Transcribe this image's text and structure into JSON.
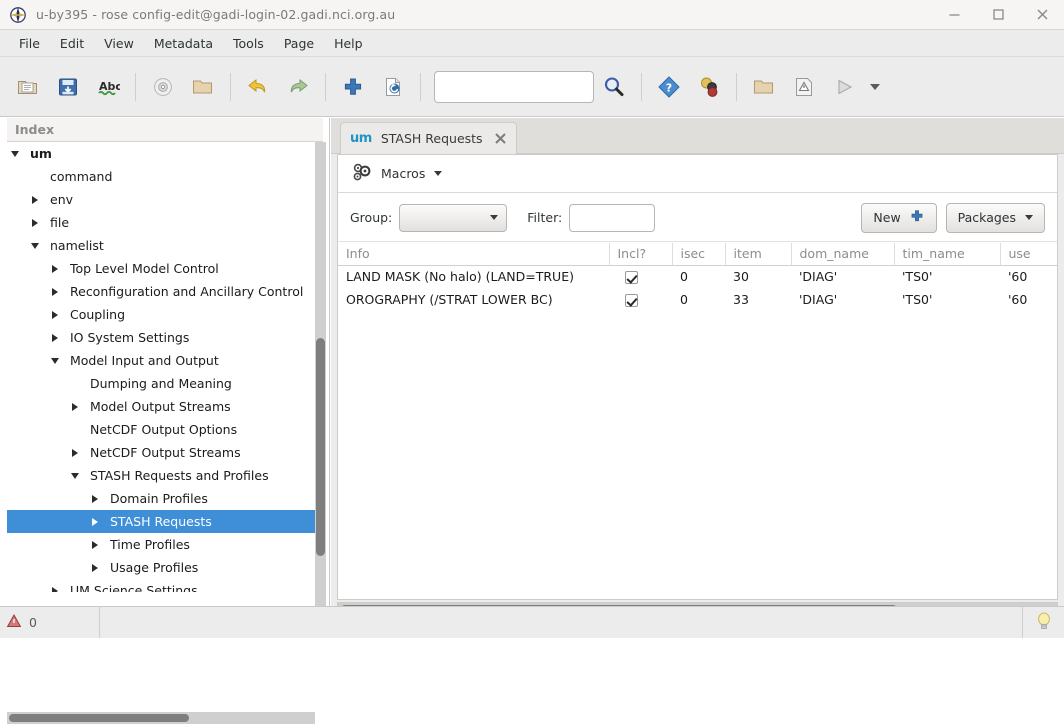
{
  "window": {
    "title": "u-by395 - rose config-edit@gadi-login-02.gadi.nci.org.au",
    "app_icon": "rose-compass-icon",
    "controls": {
      "minimize": "–",
      "maximize": "☐",
      "close": "✕"
    }
  },
  "menubar": {
    "items": [
      "File",
      "Edit",
      "View",
      "Metadata",
      "Tools",
      "Page",
      "Help"
    ]
  },
  "toolbar": {
    "buttons": [
      {
        "name": "open-icon",
        "title": "Open"
      },
      {
        "name": "save-icon",
        "title": "Save"
      },
      {
        "name": "spellcheck-icon",
        "title": "Check fix"
      },
      {
        "name": "cd-run-icon",
        "title": "Run suite"
      },
      {
        "name": "browse-folder-icon",
        "title": "Browse"
      },
      {
        "name": "undo-icon",
        "title": "Undo"
      },
      {
        "name": "redo-icon",
        "title": "Redo"
      },
      {
        "name": "add-icon",
        "title": "Add"
      },
      {
        "name": "revert-icon",
        "title": "Revert"
      }
    ],
    "search": {
      "value": "",
      "placeholder": ""
    },
    "search_button": "find-icon",
    "buttons_right": [
      {
        "name": "help-diamond-icon",
        "title": "Help"
      },
      {
        "name": "checkers-icon",
        "title": "Ignored"
      },
      {
        "name": "folder-icon",
        "title": "Folder"
      },
      {
        "name": "warning-page-icon",
        "title": "Warnings"
      },
      {
        "name": "run-icon",
        "title": "Run"
      }
    ],
    "overflow": "chevron-down-icon"
  },
  "sidebar": {
    "header": "Index",
    "tree": [
      {
        "label": "um",
        "indent": 1,
        "twisty": "down",
        "bold": true,
        "selected": false
      },
      {
        "label": "command",
        "indent": 2,
        "twisty": "none",
        "bold": false,
        "selected": false
      },
      {
        "label": "env",
        "indent": 2,
        "twisty": "right",
        "bold": false,
        "selected": false
      },
      {
        "label": "file",
        "indent": 2,
        "twisty": "right",
        "bold": false,
        "selected": false
      },
      {
        "label": "namelist",
        "indent": 2,
        "twisty": "down",
        "bold": false,
        "selected": false
      },
      {
        "label": "Top Level Model Control",
        "indent": 3,
        "twisty": "right",
        "bold": false,
        "selected": false
      },
      {
        "label": "Reconfiguration and Ancillary Control",
        "indent": 3,
        "twisty": "right",
        "bold": false,
        "selected": false
      },
      {
        "label": "Coupling",
        "indent": 3,
        "twisty": "right",
        "bold": false,
        "selected": false
      },
      {
        "label": "IO System Settings",
        "indent": 3,
        "twisty": "right",
        "bold": false,
        "selected": false
      },
      {
        "label": "Model Input and Output",
        "indent": 3,
        "twisty": "down",
        "bold": false,
        "selected": false
      },
      {
        "label": "Dumping and Meaning",
        "indent": 4,
        "twisty": "none",
        "bold": false,
        "selected": false
      },
      {
        "label": "Model Output Streams",
        "indent": 4,
        "twisty": "right",
        "bold": false,
        "selected": false
      },
      {
        "label": "NetCDF Output Options",
        "indent": 4,
        "twisty": "none",
        "bold": false,
        "selected": false
      },
      {
        "label": "NetCDF Output Streams",
        "indent": 4,
        "twisty": "right",
        "bold": false,
        "selected": false
      },
      {
        "label": "STASH Requests and Profiles",
        "indent": 4,
        "twisty": "down",
        "bold": false,
        "selected": false
      },
      {
        "label": "Domain Profiles",
        "indent": 5,
        "twisty": "right",
        "bold": false,
        "selected": false
      },
      {
        "label": "STASH Requests",
        "indent": 5,
        "twisty": "right",
        "bold": false,
        "selected": true
      },
      {
        "label": "Time Profiles",
        "indent": 5,
        "twisty": "right",
        "bold": false,
        "selected": false
      },
      {
        "label": "Usage Profiles",
        "indent": 5,
        "twisty": "right",
        "bold": false,
        "selected": false
      },
      {
        "label": "UM Science Settings",
        "indent": 3,
        "twisty": "right",
        "bold": false,
        "selected": false
      }
    ]
  },
  "main": {
    "tab": {
      "logo": "um",
      "label": "STASH Requests",
      "close": "close-icon"
    },
    "macros": {
      "icon": "macros-gears-icon",
      "label": "Macros"
    },
    "controls": {
      "group_label": "Group:",
      "group_value": "",
      "filter_label": "Filter:",
      "filter_value": "",
      "filter_placeholder": "",
      "new_button": "New",
      "packages_button": "Packages"
    },
    "table": {
      "columns": [
        "Info",
        "Incl?",
        "isec",
        "item",
        "dom_name",
        "tim_name",
        "use"
      ],
      "rows": [
        {
          "info": "LAND MASK (No halo) (LAND=TRUE)",
          "incl": true,
          "isec": "0",
          "item": "30",
          "dom_name": "'DIAG'",
          "tim_name": "'TS0'",
          "use": "'60"
        },
        {
          "info": "OROGRAPHY (/STRAT LOWER BC)",
          "incl": true,
          "isec": "0",
          "item": "33",
          "dom_name": "'DIAG'",
          "tim_name": "'TS0'",
          "use": "'60"
        }
      ]
    }
  },
  "statusbar": {
    "warning_icon": "warning-triangle-icon",
    "warning_count": "0",
    "hint_icon": "lightbulb-icon"
  },
  "colors": {
    "selection": "#3e8ed8",
    "tab_logo": "#2196c4",
    "chrome": "#ececec",
    "panel": "#ffffff"
  }
}
